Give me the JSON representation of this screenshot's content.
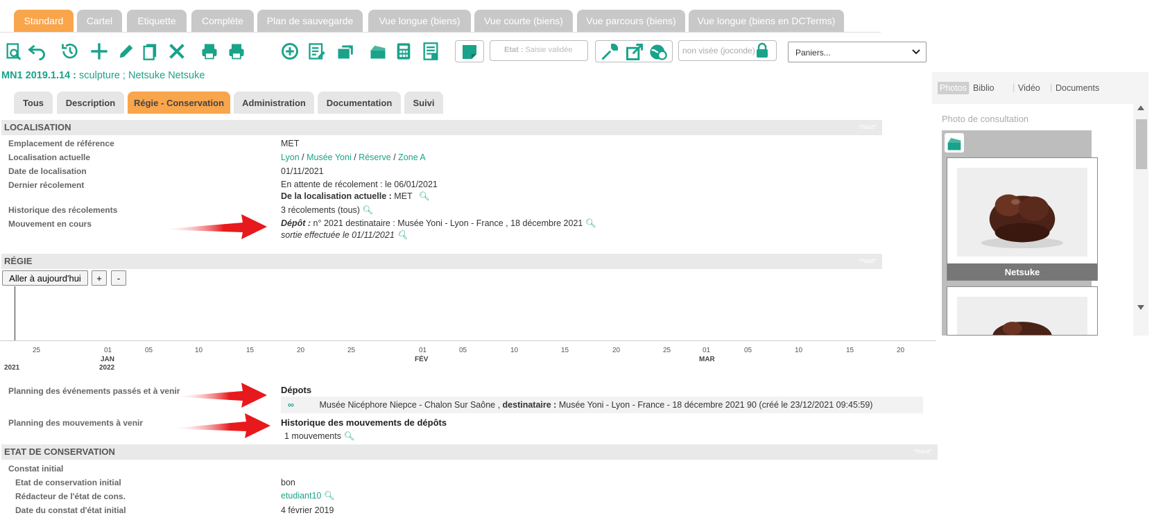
{
  "view_tabs": [
    {
      "label": "Standard",
      "active": true
    },
    {
      "label": "Cartel"
    },
    {
      "label": "Etiquette"
    },
    {
      "label": "Complète"
    },
    {
      "label": "Plan de sauvegarde"
    },
    {
      "label": "Vue longue (biens)"
    },
    {
      "label": "Vue courte (biens)"
    },
    {
      "label": "Vue parcours (biens)"
    },
    {
      "label": "Vue longue (biens en DCTerms)"
    }
  ],
  "toolbar": {
    "etat_label": "Etat :",
    "etat_value": "Saisie validée",
    "visa_label": "non visée (joconde)",
    "paniers_label": "Paniers..."
  },
  "record": {
    "id": "MN1 2019.1.14 :",
    "desc": "sculpture ; Netsuke Netsuke"
  },
  "section_tabs": [
    "Tous",
    "Description",
    "Régie - Conservation",
    "Administration",
    "Documentation",
    "Suivi"
  ],
  "haut": "^haut^",
  "localisation": {
    "title": "LOCALISATION",
    "emplacement_label": "Emplacement de référence",
    "emplacement_value": "MET",
    "loc_actuelle_label": "Localisation actuelle",
    "loc_path": [
      "Lyon",
      "Musée Yoni",
      "Réserve",
      "Zone A"
    ],
    "date_label": "Date de localisation",
    "date_value": "01/11/2021",
    "recolement_label": "Dernier récolement",
    "recolement_line1": "En attente de récolement : le 06/01/2021",
    "recolement_line2_bold": "De la localisation actuelle :",
    "recolement_line2_val": "MET",
    "hist_label": "Historique des récolements",
    "hist_value": "3 récolements (tous)",
    "mouvement_label": "Mouvement en cours",
    "mouvement_bold": "Dépôt :",
    "mouvement_value": "n° 2021 destinataire : Musée Yoni - Lyon - France , 18 décembre 2021",
    "mouvement_sortie": "sortie effectuée le 01/11/2021"
  },
  "regie": {
    "title": "RÉGIE",
    "btn_today": "Aller à aujourd'hui",
    "btn_plus": "+",
    "btn_minus": "-",
    "timeline_ticks": [
      "25",
      "01",
      "05",
      "10",
      "15",
      "20",
      "25",
      "01",
      "05",
      "10",
      "15",
      "20",
      "25",
      "01",
      "05",
      "10",
      "15",
      "20"
    ],
    "timeline_months": [
      "JAN",
      "FÉV",
      "MAR"
    ],
    "timeline_years": [
      "2021",
      "2022"
    ],
    "planning_label": "Planning des événements passés et à venir",
    "depots_title": "Dépots",
    "depot_row_from": "Musée Nicéphore Niepce - Chalon Sur Saône ,",
    "depot_row_bold": "destinataire :",
    "depot_row_rest": "Musée Yoni - Lyon - France - 18 décembre 2021  90 (créé le 23/12/2021 09:45:59)",
    "mvt_label": "Planning des mouvements à venir",
    "mvt_title": "Historique des mouvements de dépôts",
    "mvt_count": "1 mouvements"
  },
  "conservation": {
    "title": "ETAT DE CONSERVATION",
    "constat_label": "Constat initial",
    "etat_label": "Etat de conservation initial",
    "etat_value": "bon",
    "redacteur_label": "Rédacteur de l'état de cons.",
    "redacteur_value": "etudiant10",
    "date_label": "Date du constat d'état initial",
    "date_value": "4 février 2019"
  },
  "media_panel": {
    "tabs": [
      "Photos",
      "Biblio",
      "Vidéo",
      "Documents"
    ],
    "photo_heading": "Photo de consultation",
    "caption": "Netsuke"
  },
  "colors": {
    "accent": "#f9a54b",
    "teal": "#19a38a",
    "tab_grey": "#c8c8c8"
  }
}
